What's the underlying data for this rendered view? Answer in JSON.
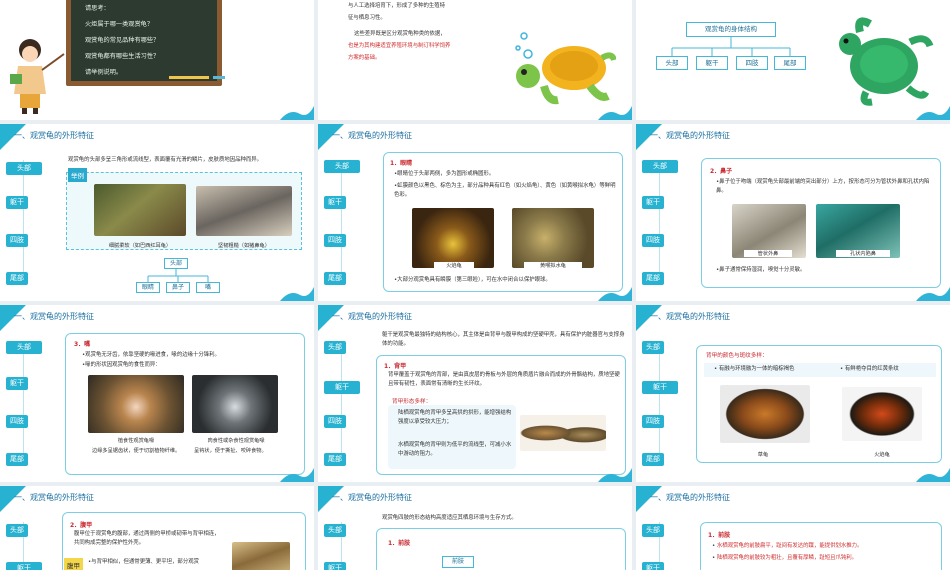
{
  "slides": {
    "s1": {
      "board_lines": [
        "请思考：",
        "火炬属于哪一类观赏龟？",
        "观赏龟的常见品种有哪些？",
        "观赏龟都有哪些生活习性？",
        "请举例说明。"
      ]
    },
    "s2": {
      "lines": [
        "与人工选择培育下，形成了多种的生殖特",
        "征与栖息习性。",
        "这些差异既是区分观赏龟种类的依据，",
        "也是为其构建适宜养殖环境与制订科学饲养",
        "方案的基础。"
      ]
    },
    "s3": {
      "title": "观赏龟的身体结构",
      "parts": [
        "头部",
        "躯干",
        "四肢",
        "尾部"
      ]
    },
    "common": {
      "section_title": "一、观赏龟的外形特征",
      "tabs": [
        "头部",
        "躯干",
        "四肢",
        "尾部"
      ]
    },
    "s4": {
      "intro": "观赏龟的头部多呈三角形或流线型，表面覆有光滑的鳞片，皮肤质地因品种而异。",
      "example_tag": "举例",
      "cap1": "细腻柔软（如巴西红耳龟）",
      "cap2": "坚韧粗糙（如猪鼻龟）",
      "tree_root": "头部",
      "tree_children": [
        "眼睛",
        "鼻子",
        "嘴"
      ]
    },
    "s5": {
      "heading": "1．眼睛",
      "b1": "•眼睛位于头部两侧，多为圆形或椭圆形。",
      "b2": "•虹膜颜色以黑色、棕色为主，部分品种具有红色（如火焰龟）、黄色（如黄喉拟水龟）等鲜明色彩。",
      "cap1": "火焰龟",
      "cap2": "黄喉拟水龟",
      "b3": "•大部分观赏龟具有瞬膜（第三眼睑），可在水中闭合以保护眼球。"
    },
    "s6": {
      "heading": "2．鼻子",
      "b1": "•鼻子位于吻端（观赏龟头部最前端的突出部分）上方，按形态可分为管状外鼻和孔状内陷鼻。",
      "cap1": "管状外鼻",
      "cap2": "孔状内陷鼻",
      "b2": "•鼻子通常保持湿润，嗅觉十分灵敏。"
    },
    "s7": {
      "heading": "3．嘴",
      "b1": "•观赏龟无牙齿，依靠坚硬的喙进食，喙的边缘十分锋利。",
      "b2": "•喙的形状因观赏龟的食性而异：",
      "cap1": "植食性观赏龟喙",
      "cap1b": "边缘多呈锯齿状，便于切割植物纤维。",
      "cap2": "肉食性或杂食性观赏龟喙",
      "cap2b": "呈钩状，便于撕扯、咬碎食物。"
    },
    "s8": {
      "intro": "躯干是观赏龟最独特的结构核心，其主体是由背甲与腹甲构成的坚硬甲壳，具有保护内脏器官与支撑身体的功能。",
      "heading": "1．背甲",
      "p1": "背甲覆盖于观赏龟的背部，是由真皮层的骨板与外层的角质盾片融合而成的外骨骼结构，质地坚硬且带有韧性，表面常有清晰的生长环纹。",
      "sub": "背甲形态多样：",
      "l1": "陆栖观赏龟的背甲多呈高拱的拱形，能增强结构强度以承受较大压力；",
      "l2": "水栖观赏龟的背甲则为低平的流线型，可减小水中游动的阻力。"
    },
    "s9": {
      "sub": "背甲的颜色与斑纹多样：",
      "l1": "有融与环境融为一体的暗棕褐色",
      "l2": "有鲜艳夺目的红黄条纹",
      "cap1": "草龟",
      "cap2": "火焰龟"
    },
    "s10": {
      "heading": "2．腹甲",
      "p1": "腹甲位于观赏龟的腹部，通过两侧的甲桥或韧带与背甲相连，共同构成完整的保护性外壳。",
      "tag": "腹甲",
      "p2": "•与背甲相似，但通常更薄、更平坦，部分观赏"
    },
    "s11": {
      "intro": "观赏龟四肢的形态结构高度适应其栖息环境与生存方式。",
      "heading": "1．前肢",
      "box": "前肢"
    },
    "s12": {
      "heading": "1．前肢",
      "l1": "水栖观赏龟的前肢扁平，趾间有发达的蹼，能提供划水推力。",
      "l2": "陆栖观赏龟的前肢较为粗壮，且覆有厚鳞，趾短且爪钝利。"
    }
  }
}
